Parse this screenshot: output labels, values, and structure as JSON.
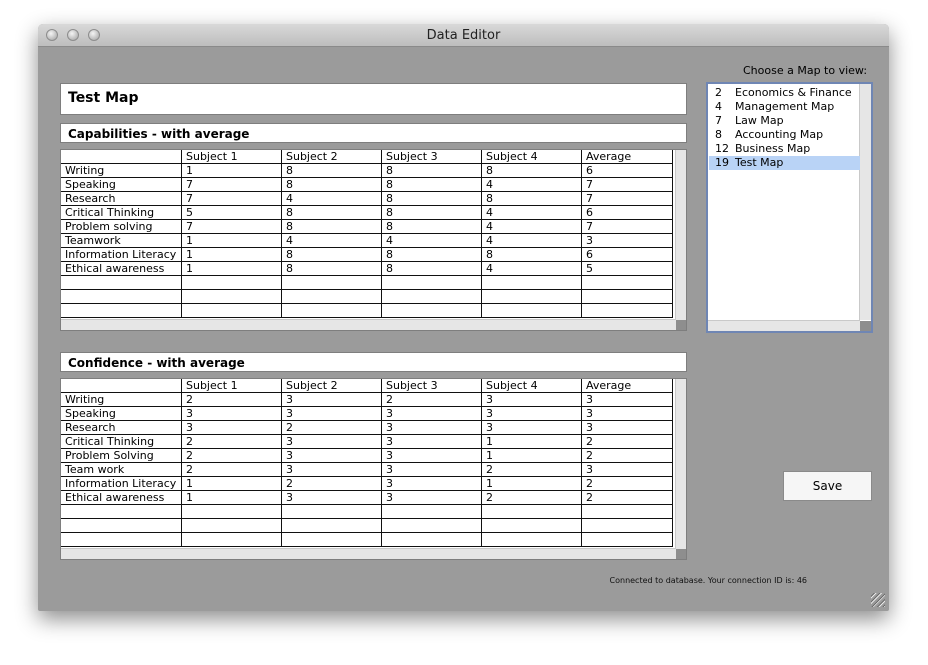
{
  "window": {
    "title": "Data Editor"
  },
  "map_title": "Test Map",
  "capabilities": {
    "title": "Capabilities - with average",
    "columns": [
      "",
      "Subject 1",
      "Subject 2",
      "Subject 3",
      "Subject 4",
      "Average"
    ],
    "rows": [
      [
        "Writing",
        "1",
        "8",
        "8",
        "8",
        "6"
      ],
      [
        "Speaking",
        "7",
        "8",
        "8",
        "4",
        "7"
      ],
      [
        "Research",
        "7",
        "4",
        "8",
        "8",
        "7"
      ],
      [
        "Critical Thinking",
        "5",
        "8",
        "8",
        "4",
        "6"
      ],
      [
        "Problem solving",
        "7",
        "8",
        "8",
        "4",
        "7"
      ],
      [
        "Teamwork",
        "1",
        "4",
        "4",
        "4",
        "3"
      ],
      [
        "Information Literacy",
        "1",
        "8",
        "8",
        "8",
        "6"
      ],
      [
        "Ethical awareness",
        "1",
        "8",
        "8",
        "4",
        "5"
      ],
      [
        "",
        "",
        "",
        "",
        "",
        ""
      ],
      [
        "",
        "",
        "",
        "",
        "",
        ""
      ],
      [
        "",
        "",
        "",
        "",
        "",
        ""
      ]
    ]
  },
  "confidence": {
    "title": "Confidence - with average",
    "columns": [
      "",
      "Subject 1",
      "Subject 2",
      "Subject 3",
      "Subject 4",
      "Average"
    ],
    "rows": [
      [
        "Writing",
        "2",
        "3",
        "2",
        "3",
        "3"
      ],
      [
        "Speaking",
        "3",
        "3",
        "3",
        "3",
        "3"
      ],
      [
        "Research",
        "3",
        "2",
        "3",
        "3",
        "3"
      ],
      [
        "Critical Thinking",
        "2",
        "3",
        "3",
        "1",
        "2"
      ],
      [
        "Problem Solving",
        "2",
        "3",
        "3",
        "1",
        "2"
      ],
      [
        "Team work",
        "2",
        "3",
        "3",
        "2",
        "3"
      ],
      [
        "Information Literacy",
        "1",
        "2",
        "3",
        "1",
        "2"
      ],
      [
        "Ethical awareness",
        "1",
        "3",
        "3",
        "2",
        "2"
      ],
      [
        "",
        "",
        "",
        "",
        "",
        ""
      ],
      [
        "",
        "",
        "",
        "",
        "",
        ""
      ],
      [
        "",
        "",
        "",
        "",
        "",
        ""
      ]
    ]
  },
  "map_chooser": {
    "label": "Choose a Map to view:",
    "items": [
      {
        "id": "2",
        "name": "Economics & Finance",
        "selected": false
      },
      {
        "id": "4",
        "name": "Management Map",
        "selected": false
      },
      {
        "id": "7",
        "name": "Law Map",
        "selected": false
      },
      {
        "id": "8",
        "name": "Accounting Map",
        "selected": false
      },
      {
        "id": "12",
        "name": "Business Map",
        "selected": false
      },
      {
        "id": "19",
        "name": "Test Map",
        "selected": true
      }
    ]
  },
  "save_label": "Save",
  "status_text": "Connected to database. Your connection ID is: 46",
  "colors": {
    "window_bg": "#9b9b9b",
    "selection": "#b9d3f6",
    "list_border": "#6f86b4"
  }
}
